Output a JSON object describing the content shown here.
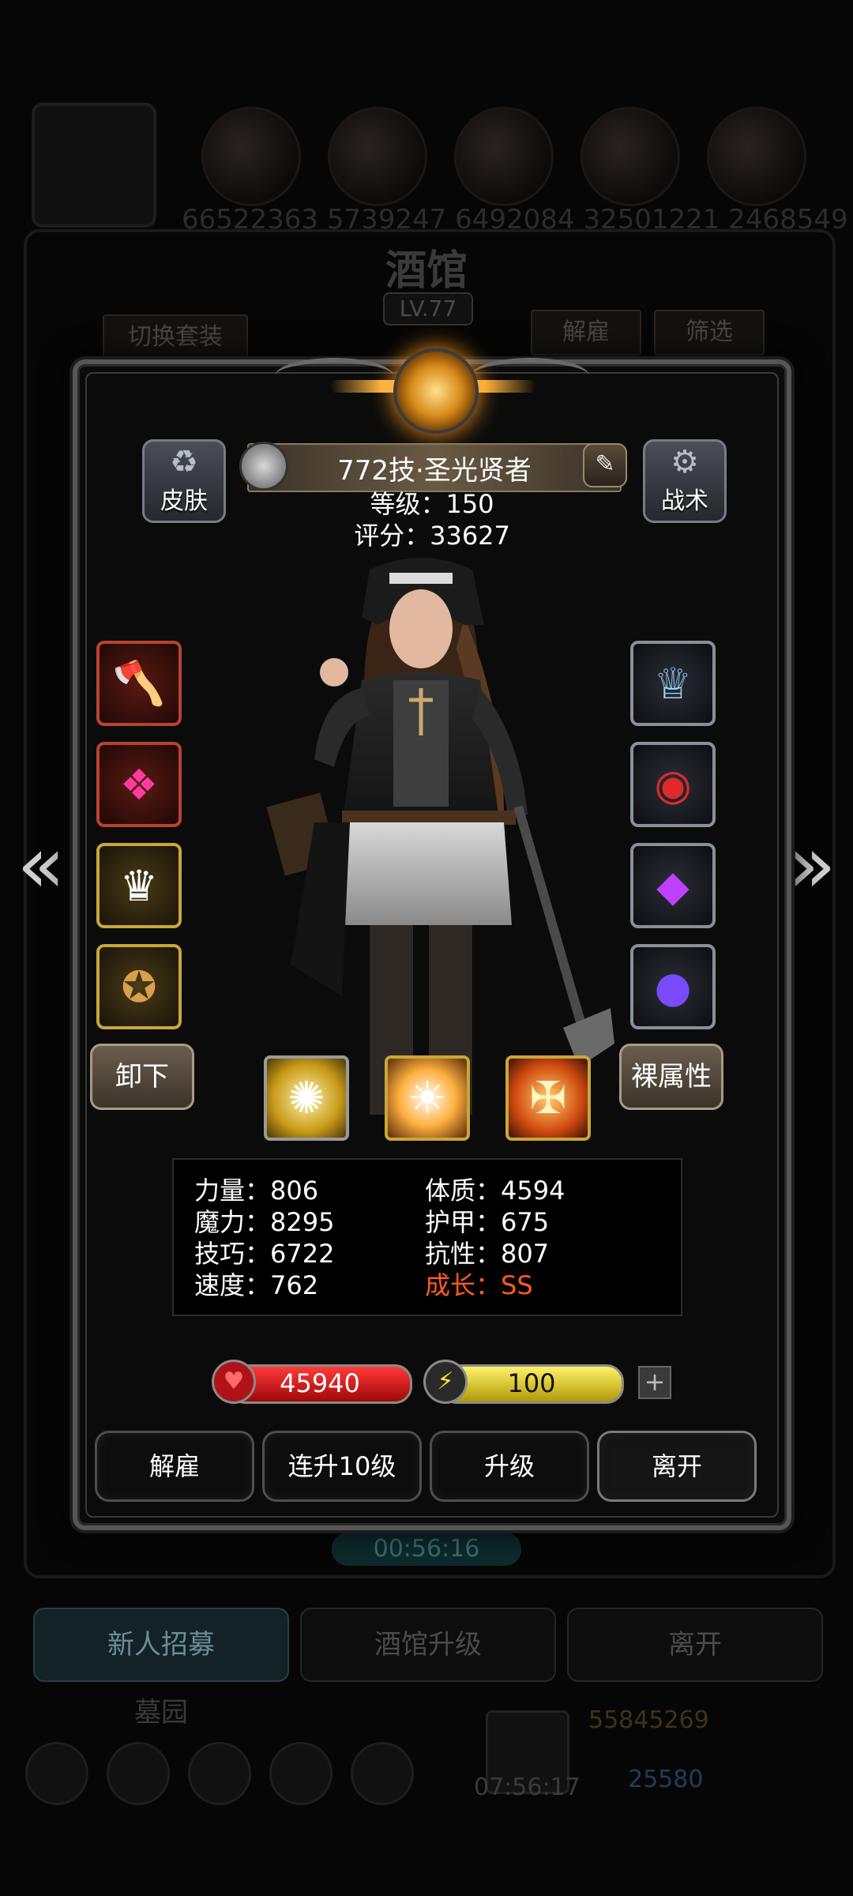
{
  "background": {
    "top_numbers": "66522363 5739247 6492084 32501221 2468549",
    "title": "酒馆",
    "level": "LV.77",
    "switch_set": "切换套装",
    "dismiss": "解雇",
    "filter": "筛选",
    "timer": "00:56:16",
    "recruit": "新人招募",
    "tavern_upgrade": "酒馆升级",
    "leave": "离开",
    "graveyard": "墓园",
    "gold": "55845269",
    "gems": "25580",
    "chest_timer": "07:56:17"
  },
  "hero": {
    "skin_label": "皮肤",
    "tactics_label": "战术",
    "name": "772技·圣光贤者",
    "level": "等级：150",
    "score": "评分：33627"
  },
  "equipment": {
    "left": [
      "axe-icon",
      "armor-icon",
      "crown-icon",
      "amulet-icon"
    ],
    "right": [
      "tiara-icon",
      "ring-icon",
      "gem-icon",
      "orb-icon"
    ]
  },
  "actions": {
    "unload": "卸下",
    "naked_attr": "裸属性",
    "dismiss": "解雇",
    "upgrade10": "连升10级",
    "upgrade": "升级",
    "leave": "离开"
  },
  "skills": [
    "light-burst-icon",
    "holy-sun-icon",
    "holy-shield-icon"
  ],
  "stats": {
    "strength": "力量：806",
    "magic": "魔力：8295",
    "skill": "技巧：6722",
    "speed": "速度：762",
    "constitution": "体质：4594",
    "armor": "护甲：675",
    "resistance": "抗性：807",
    "growth": "成长：SS"
  },
  "bars": {
    "hp": "45940",
    "energy": "100"
  },
  "colors": {
    "hp": "#c81414",
    "energy": "#e8d21a",
    "growth": "#ff5a1e"
  }
}
